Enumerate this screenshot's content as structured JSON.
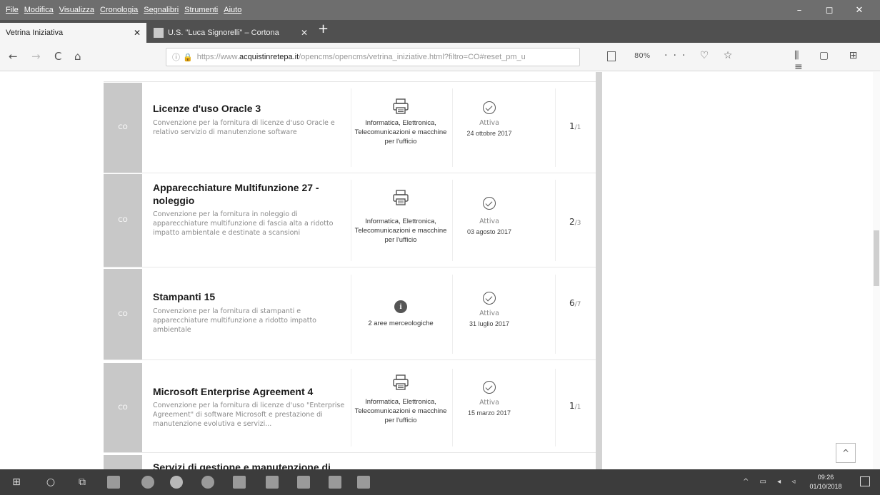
{
  "menubar": {
    "items": [
      "File",
      "Modifica",
      "Visualizza",
      "Cronologia",
      "Segnalibri",
      "Strumenti",
      "Aiuto"
    ],
    "window_controls": [
      "–",
      "◻",
      "✕"
    ]
  },
  "tabs": [
    {
      "label": "Vetrina Iniziativa",
      "close": "✕"
    },
    {
      "label": "U.S. \"Luca Signorelli\" – Cortona",
      "close": "✕"
    }
  ],
  "new_tab": "+",
  "nav": {
    "back": "←",
    "forward": "→",
    "reload": "C",
    "home": "⌂",
    "url_prefix": "https://www.",
    "url_domain": "acquistinretepa.it",
    "url_path": "/opencms/opencms/vetrina_iniziative.html?filtro=CO#reset_pm_u",
    "zoom": "80%",
    "page_actions": "··· ♡ ☆",
    "toolbar_right": "⫼ ▢ ⊞ ≡"
  },
  "cards": [
    {
      "tag": "CO",
      "title": "Licenze d'uso Oracle 3",
      "desc": "Convenzione per la fornitura di licenze d'uso Oracle e relativo servizio di manutenzione software",
      "category": "Informatica, Elettronica, Telecomunicazioni e macchine per l'ufficio",
      "state": "Attiva",
      "date": "24 ottobre 2017",
      "count": "1",
      "of": "/1"
    },
    {
      "tag": "CO",
      "title": "Apparecchiature Multifunzione 27 - noleggio",
      "desc": "Convenzione per la fornitura in noleggio di apparecchiature multifunzione di fascia alta a ridotto impatto ambientale e destinate a scansioni",
      "category": "Informatica, Elettronica, Telecomunicazioni e macchine per l'ufficio",
      "state": "Attiva",
      "date": "03 agosto 2017",
      "count": "2",
      "of": "/3"
    },
    {
      "tag": "CO",
      "title": "Stampanti 15",
      "desc": "Convenzione per la fornitura di stampanti e apparecchiature multifunzione a ridotto impatto ambientale",
      "category": "2 aree merceologiche",
      "state": "Attiva",
      "date": "31 luglio 2017",
      "count": "6",
      "of": "/7"
    },
    {
      "tag": "CO",
      "title": "Microsoft Enterprise Agreement 4",
      "desc": "Convenzione per la fornitura di licenze d'uso \"Enterprise Agreement\" di software Microsoft e prestazione di manutenzione evolutiva e servizi...",
      "category": "Informatica, Elettronica, Telecomunicazioni e macchine per l'ufficio",
      "state": "Attiva",
      "date": "15 marzo 2017",
      "count": "1",
      "of": "/1"
    },
    {
      "tag": "",
      "title": "Servizi di gestione e manutenzione di",
      "desc": "",
      "category": "",
      "state": "",
      "date": "",
      "count": "",
      "of": ""
    }
  ],
  "back_to_top": "^",
  "taskbar": {
    "time": "09:26",
    "date": "01/10/2018"
  }
}
